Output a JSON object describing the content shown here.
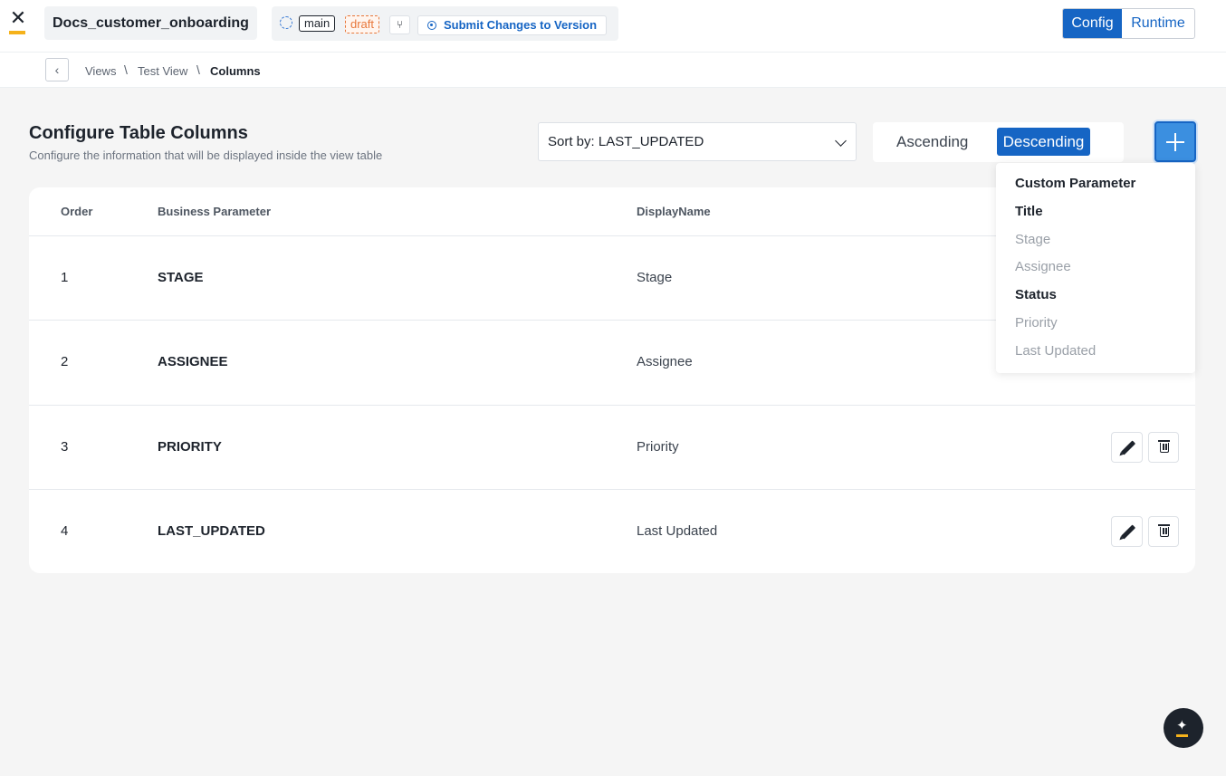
{
  "header": {
    "app_name": "Docs_customer_onboarding",
    "branch": "main",
    "status": "draft",
    "submit_label": "Submit Changes to Version",
    "modes": [
      "Config",
      "Runtime"
    ],
    "active_mode": "Config",
    "brand_color": "#1665c4",
    "accent_color": "#f5b21b"
  },
  "breadcrumb": {
    "items": [
      "Views",
      "Test View",
      "Columns"
    ],
    "separator": "\\"
  },
  "page": {
    "title": "Configure Table Columns",
    "subtitle": "Configure the information that will be displayed inside the view table"
  },
  "sort": {
    "value": "Sort by: LAST_UPDATED",
    "ascending_label": "Ascending",
    "descending_label": "Descending",
    "selected": "Descending"
  },
  "table": {
    "headers": [
      "Order",
      "Business Parameter",
      "DisplayName"
    ],
    "rows": [
      {
        "order": "1",
        "param": "STAGE",
        "display": "Stage"
      },
      {
        "order": "2",
        "param": "ASSIGNEE",
        "display": "Assignee"
      },
      {
        "order": "3",
        "param": "PRIORITY",
        "display": "Priority"
      },
      {
        "order": "4",
        "param": "LAST_UPDATED",
        "display": "Last Updated"
      }
    ]
  },
  "add_menu": {
    "items": [
      {
        "label": "Custom Parameter",
        "enabled": true
      },
      {
        "label": "Title",
        "enabled": true
      },
      {
        "label": "Stage",
        "enabled": false
      },
      {
        "label": "Assignee",
        "enabled": false
      },
      {
        "label": "Status",
        "enabled": true
      },
      {
        "label": "Priority",
        "enabled": false
      },
      {
        "label": "Last Updated",
        "enabled": false
      }
    ]
  },
  "icons": {
    "logo": "x-logo-icon",
    "fab": "ai-sparkle-icon"
  }
}
